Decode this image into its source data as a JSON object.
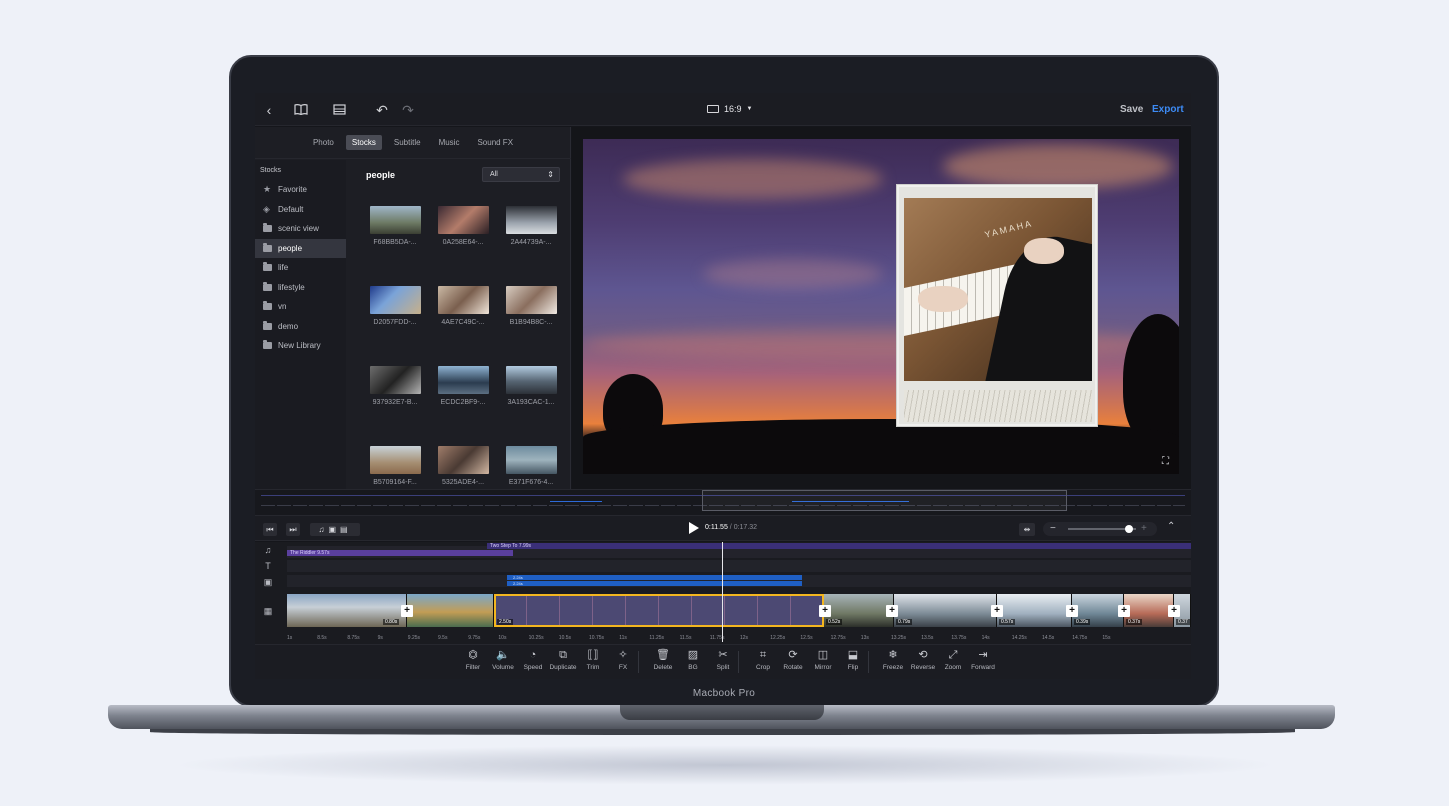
{
  "device": {
    "model_label": "Macbook Pro"
  },
  "topbar": {
    "icons": [
      "back-icon",
      "library-icon",
      "panel-icon",
      "undo-icon",
      "redo-icon"
    ],
    "aspect_ratio": "16:9",
    "save_label": "Save",
    "export_label": "Export",
    "accent": "#3d8bf5"
  },
  "library": {
    "tabs": [
      {
        "label": "Photo"
      },
      {
        "label": "Stocks",
        "active": true
      },
      {
        "label": "Subtitle"
      },
      {
        "label": "Music"
      },
      {
        "label": "Sound FX"
      }
    ],
    "sidebar_title": "Stocks",
    "sidebar_items": [
      {
        "label": "Favorite",
        "icon": "star-icon"
      },
      {
        "label": "Default",
        "icon": "stack-icon"
      },
      {
        "label": "scenic view",
        "icon": "folder-icon"
      },
      {
        "label": "people",
        "icon": "folder-icon",
        "selected": true
      },
      {
        "label": "life",
        "icon": "folder-icon"
      },
      {
        "label": "lifestyle",
        "icon": "folder-icon"
      },
      {
        "label": "vn",
        "icon": "folder-icon"
      },
      {
        "label": "demo",
        "icon": "folder-icon"
      },
      {
        "label": "New Library",
        "icon": "folder-icon"
      }
    ],
    "folder_title": "people",
    "filter_value": "All",
    "thumbs": [
      {
        "caption": "F68BB5DA-..."
      },
      {
        "caption": "0A258E64-..."
      },
      {
        "caption": "2A44739A-..."
      },
      {
        "caption": "D2057FDD-..."
      },
      {
        "caption": "4AE7C49C-..."
      },
      {
        "caption": "B1B94B8C-..."
      },
      {
        "caption": "937932E7-B..."
      },
      {
        "caption": "ECDC2BF9-..."
      },
      {
        "caption": "3A193CAC-1..."
      },
      {
        "caption": "B5709164-F..."
      },
      {
        "caption": "5325ADE4-..."
      },
      {
        "caption": "E371F676-4..."
      }
    ]
  },
  "preview": {
    "overlay_brand": "YAMAHA"
  },
  "controls": {
    "current_time": "0:11.55",
    "separator": "/",
    "duration": "0:17.32"
  },
  "timeline": {
    "audio_tracks": [
      {
        "label": "Two Step To  7.99s"
      },
      {
        "label": "The Riddler  9.57s"
      }
    ],
    "effect_tracks": [
      {
        "label": "2.24s"
      },
      {
        "label": "2.24s"
      }
    ],
    "clip_labels": [
      "0.80s",
      "2.50s",
      "0.52s",
      "0.79s",
      "0.57s",
      "0.39s",
      "0.37s",
      "0.37"
    ],
    "ruler": [
      "1s",
      "8.5s",
      "8.75s",
      "9s",
      "9.25s",
      "9.5s",
      "9.75s",
      "10s",
      "10.25s",
      "10.5s",
      "10.75s",
      "11s",
      "11.25s",
      "11.5s",
      "11.75s",
      "12s",
      "12.25s",
      "12.5s",
      "12.75s",
      "13s",
      "13.25s",
      "13.5s",
      "13.75s",
      "14s",
      "14.25s",
      "14.5s",
      "14.75s",
      "15s"
    ]
  },
  "tools": [
    {
      "label": "Filter",
      "icon": "filter-icon"
    },
    {
      "label": "Volume",
      "icon": "volume-icon"
    },
    {
      "label": "Speed",
      "icon": "speed-icon"
    },
    {
      "label": "Duplicate",
      "icon": "duplicate-icon"
    },
    {
      "label": "Trim",
      "icon": "trim-icon"
    },
    {
      "label": "FX",
      "icon": "fx-icon"
    },
    {
      "label": "Delete",
      "icon": "delete-icon"
    },
    {
      "label": "BG",
      "icon": "bg-icon"
    },
    {
      "label": "Split",
      "icon": "scissors-icon"
    },
    {
      "label": "Crop",
      "icon": "crop-icon"
    },
    {
      "label": "Rotate",
      "icon": "rotate-icon"
    },
    {
      "label": "Mirror",
      "icon": "mirror-icon"
    },
    {
      "label": "Flip",
      "icon": "flip-icon"
    },
    {
      "label": "Freeze",
      "icon": "freeze-icon"
    },
    {
      "label": "Reverse",
      "icon": "reverse-icon"
    },
    {
      "label": "Zoom",
      "icon": "zoom-icon"
    },
    {
      "label": "Forward",
      "icon": "forward-icon"
    }
  ]
}
